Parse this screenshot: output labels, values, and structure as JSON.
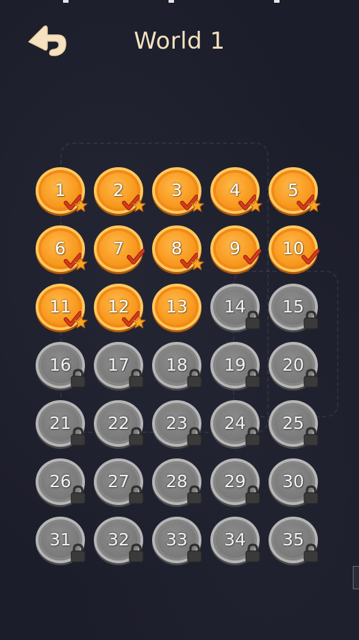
{
  "header": {
    "title": "World 1",
    "back_icon": "back-arrow-icon"
  },
  "colors": {
    "background": "#1c1d2a",
    "title": "#f5e2c0",
    "unlocked_coin": "#f89a1f",
    "locked_coin": "#7a7a7a",
    "check": "#d63a1e",
    "star": "#f7a823"
  },
  "levels": [
    {
      "number": "1",
      "state": "unlocked",
      "completed": true,
      "star": true
    },
    {
      "number": "2",
      "state": "unlocked",
      "completed": true,
      "star": true
    },
    {
      "number": "3",
      "state": "unlocked",
      "completed": true,
      "star": true
    },
    {
      "number": "4",
      "state": "unlocked",
      "completed": true,
      "star": true
    },
    {
      "number": "5",
      "state": "unlocked",
      "completed": true,
      "star": true
    },
    {
      "number": "6",
      "state": "unlocked",
      "completed": true,
      "star": true
    },
    {
      "number": "7",
      "state": "unlocked",
      "completed": true,
      "star": false
    },
    {
      "number": "8",
      "state": "unlocked",
      "completed": true,
      "star": true
    },
    {
      "number": "9",
      "state": "unlocked",
      "completed": true,
      "star": false
    },
    {
      "number": "10",
      "state": "unlocked",
      "completed": true,
      "star": false
    },
    {
      "number": "11",
      "state": "unlocked",
      "completed": true,
      "star": true
    },
    {
      "number": "12",
      "state": "unlocked",
      "completed": true,
      "star": true
    },
    {
      "number": "13",
      "state": "unlocked",
      "completed": false,
      "star": false
    },
    {
      "number": "14",
      "state": "locked"
    },
    {
      "number": "15",
      "state": "locked"
    },
    {
      "number": "16",
      "state": "locked"
    },
    {
      "number": "17",
      "state": "locked"
    },
    {
      "number": "18",
      "state": "locked"
    },
    {
      "number": "19",
      "state": "locked"
    },
    {
      "number": "20",
      "state": "locked"
    },
    {
      "number": "21",
      "state": "locked"
    },
    {
      "number": "22",
      "state": "locked"
    },
    {
      "number": "23",
      "state": "locked"
    },
    {
      "number": "24",
      "state": "locked"
    },
    {
      "number": "25",
      "state": "locked"
    },
    {
      "number": "26",
      "state": "locked"
    },
    {
      "number": "27",
      "state": "locked"
    },
    {
      "number": "28",
      "state": "locked"
    },
    {
      "number": "29",
      "state": "locked"
    },
    {
      "number": "30",
      "state": "locked"
    },
    {
      "number": "31",
      "state": "locked"
    },
    {
      "number": "32",
      "state": "locked"
    },
    {
      "number": "33",
      "state": "locked"
    },
    {
      "number": "34",
      "state": "locked"
    },
    {
      "number": "35",
      "state": "locked"
    }
  ]
}
